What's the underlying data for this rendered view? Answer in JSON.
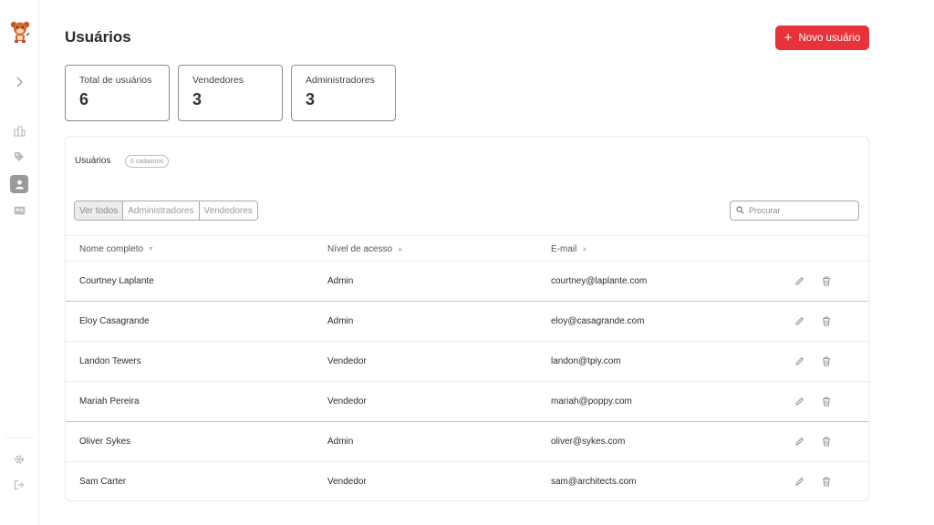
{
  "page": {
    "title": "Usuários",
    "new_user_label": "Novo usuário",
    "new_user_icon": "plus-icon"
  },
  "stats": [
    {
      "label": "Total de usuários",
      "value": "6"
    },
    {
      "label": "Vendedores",
      "value": "3"
    },
    {
      "label": "Administradores",
      "value": "3"
    }
  ],
  "panel": {
    "title": "Usuários",
    "count_badge": "6 cadastros",
    "filters": [
      "Ver todos",
      "Administradores",
      "Vendedores"
    ],
    "active_filter": "Ver todos",
    "search_placeholder": "Procurar"
  },
  "table": {
    "columns": [
      "Nome completo",
      "Nível de acesso",
      "E-mail"
    ],
    "sort_arrows": [
      "▼",
      "▲",
      "▲"
    ],
    "rows": [
      {
        "name": "Courtney Laplante",
        "role": "Admin",
        "email": "courtney@laplante.com"
      },
      {
        "name": "Eloy Casagrande",
        "role": "Admin",
        "email": "eloy@casagrande.com"
      },
      {
        "name": "Landon Tewers",
        "role": "Vendedor",
        "email": "landon@tpiy.com"
      },
      {
        "name": "Mariah Pereira",
        "role": "Vendedor",
        "email": "mariah@poppy.com"
      },
      {
        "name": "Oliver Sykes",
        "role": "Admin",
        "email": "oliver@sykes.com"
      },
      {
        "name": "Sam Carter",
        "role": "Vendedor",
        "email": "sam@architects.com"
      }
    ]
  },
  "sidebar": {
    "items": [
      "chevron-right-icon",
      "dashboard-icon",
      "tag-icon",
      "user-icon",
      "id-card-icon",
      "gear-icon",
      "logout-icon"
    ],
    "active": "user-icon"
  },
  "colors": {
    "accent": "#e8323b",
    "active_sidebar": "#9a9a9a"
  }
}
